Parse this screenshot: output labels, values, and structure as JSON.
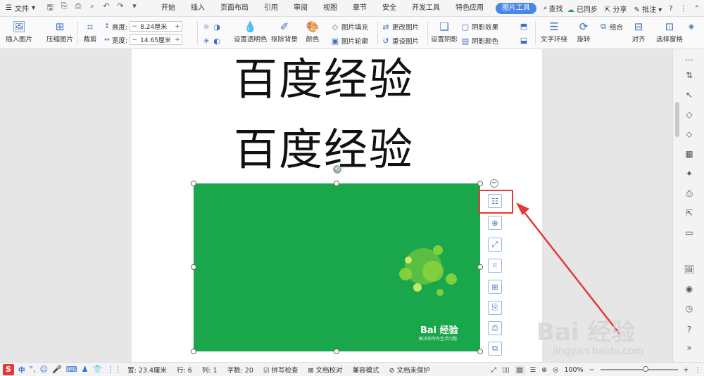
{
  "menubar": {
    "file_label": "文件",
    "tabs": [
      "开始",
      "插入",
      "页面布局",
      "引用",
      "审阅",
      "视图",
      "章节",
      "安全",
      "开发工具",
      "特色应用",
      "图片工具"
    ],
    "active_tab_index": 10,
    "search_label": "查找",
    "sync_label": "已同步",
    "share_label": "分享",
    "comment_label": "批注",
    "help_label": "?"
  },
  "ribbon": {
    "insert_image": "插入图片",
    "compress_image": "压缩图片",
    "crop": "裁剪",
    "height_label": "高度:",
    "height_value": "8.24厘米",
    "width_label": "宽度:",
    "width_value": "14.65厘米",
    "set_transparent": "设置透明色",
    "remove_bg": "抠除背景",
    "color": "颜色",
    "image_fill": "图片填充",
    "image_outline": "图片轮廓",
    "change_image": "更改图片",
    "reset_image": "重设图片",
    "set_shadow": "设置阴影",
    "shadow_effect": "阴影效果",
    "shadow_color": "阴影颜色",
    "text_wrap": "文字环绕",
    "rotate": "旋转",
    "group": "组合",
    "align": "对齐",
    "select_pane": "选择窗格"
  },
  "document": {
    "line1": "百度经验",
    "line2": "百度经验",
    "image_logo": "Bai 经验",
    "image_slogan": "解决你所有生活问题"
  },
  "watermark": {
    "main": "Bai 经验",
    "sub": "jingyan.baidu.com"
  },
  "statusbar": {
    "ime": [
      "中",
      "°,",
      "☺",
      "🎤",
      "⌨"
    ],
    "items": [
      "置: 23.4厘米",
      "行: 6",
      "列: 1",
      "字数: 20",
      "拼写检查",
      "文档校对",
      "兼容模式",
      "文档未保护"
    ],
    "zoom": "100%"
  },
  "colors": {
    "image_bg": "#1aa64a",
    "accent": "#4a86e8",
    "highlight": "#e53935"
  }
}
